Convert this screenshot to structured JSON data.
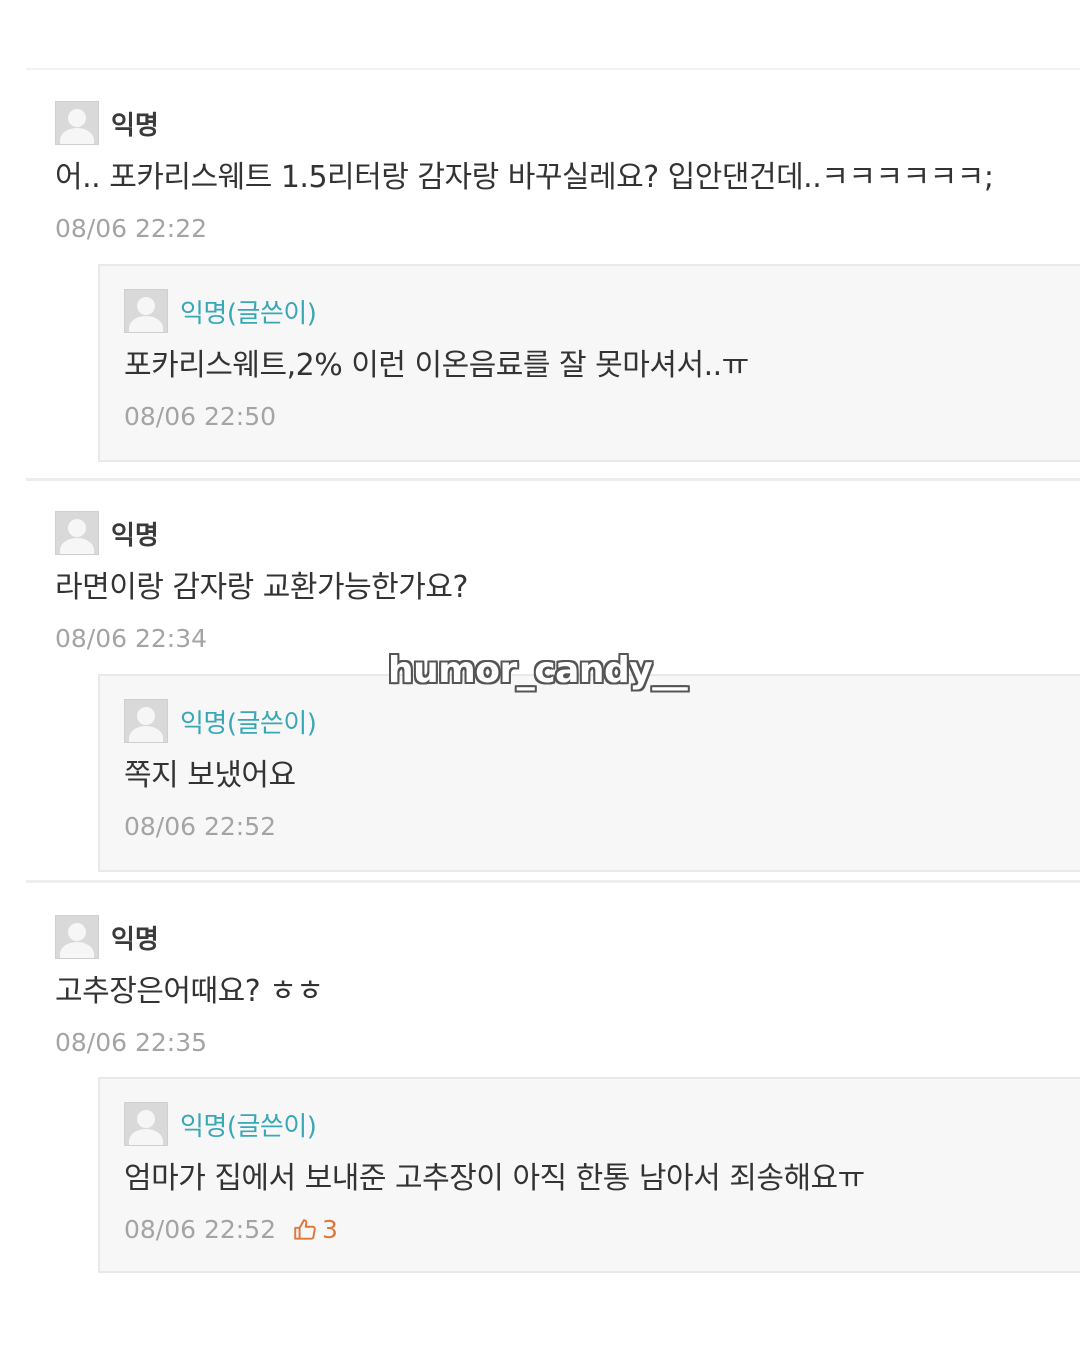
{
  "threads": [
    {
      "comment": {
        "author": "익명",
        "text": "어.. 포카리스웨트 1.5리터랑 감자랑 바꾸실레요? 입안댄건데..ㅋㅋㅋㅋㅋㅋ;",
        "time": "08/06 22:22"
      },
      "reply": {
        "author": "익명(글쓴이)",
        "text": "포카리스웨트,2% 이런 이온음료를 잘 못마셔서..ㅠ",
        "time": "08/06 22:50"
      }
    },
    {
      "comment": {
        "author": "익명",
        "text": "라면이랑 감자랑 교환가능한가요?",
        "time": "08/06 22:34"
      },
      "reply": {
        "author": "익명(글쓴이)",
        "text": "쪽지 보냈어요",
        "time": "08/06 22:52"
      }
    },
    {
      "comment": {
        "author": "익명",
        "text": "고추장은어때요? ㅎㅎ",
        "time": "08/06 22:35"
      },
      "reply": {
        "author": "익명(글쓴이)",
        "text": "엄마가 집에서 보내준 고추장이 아직 한통 남아서 죄송해요ㅠ",
        "time": "08/06 22:52",
        "likes": "3"
      }
    }
  ],
  "watermark": "humor_candy__",
  "colors": {
    "op_author": "#39a8b6",
    "like": "#e0763a",
    "timestamp": "#a4a4a4"
  },
  "icons": {
    "avatar": "default-avatar-icon",
    "like": "thumbs-up-icon"
  }
}
